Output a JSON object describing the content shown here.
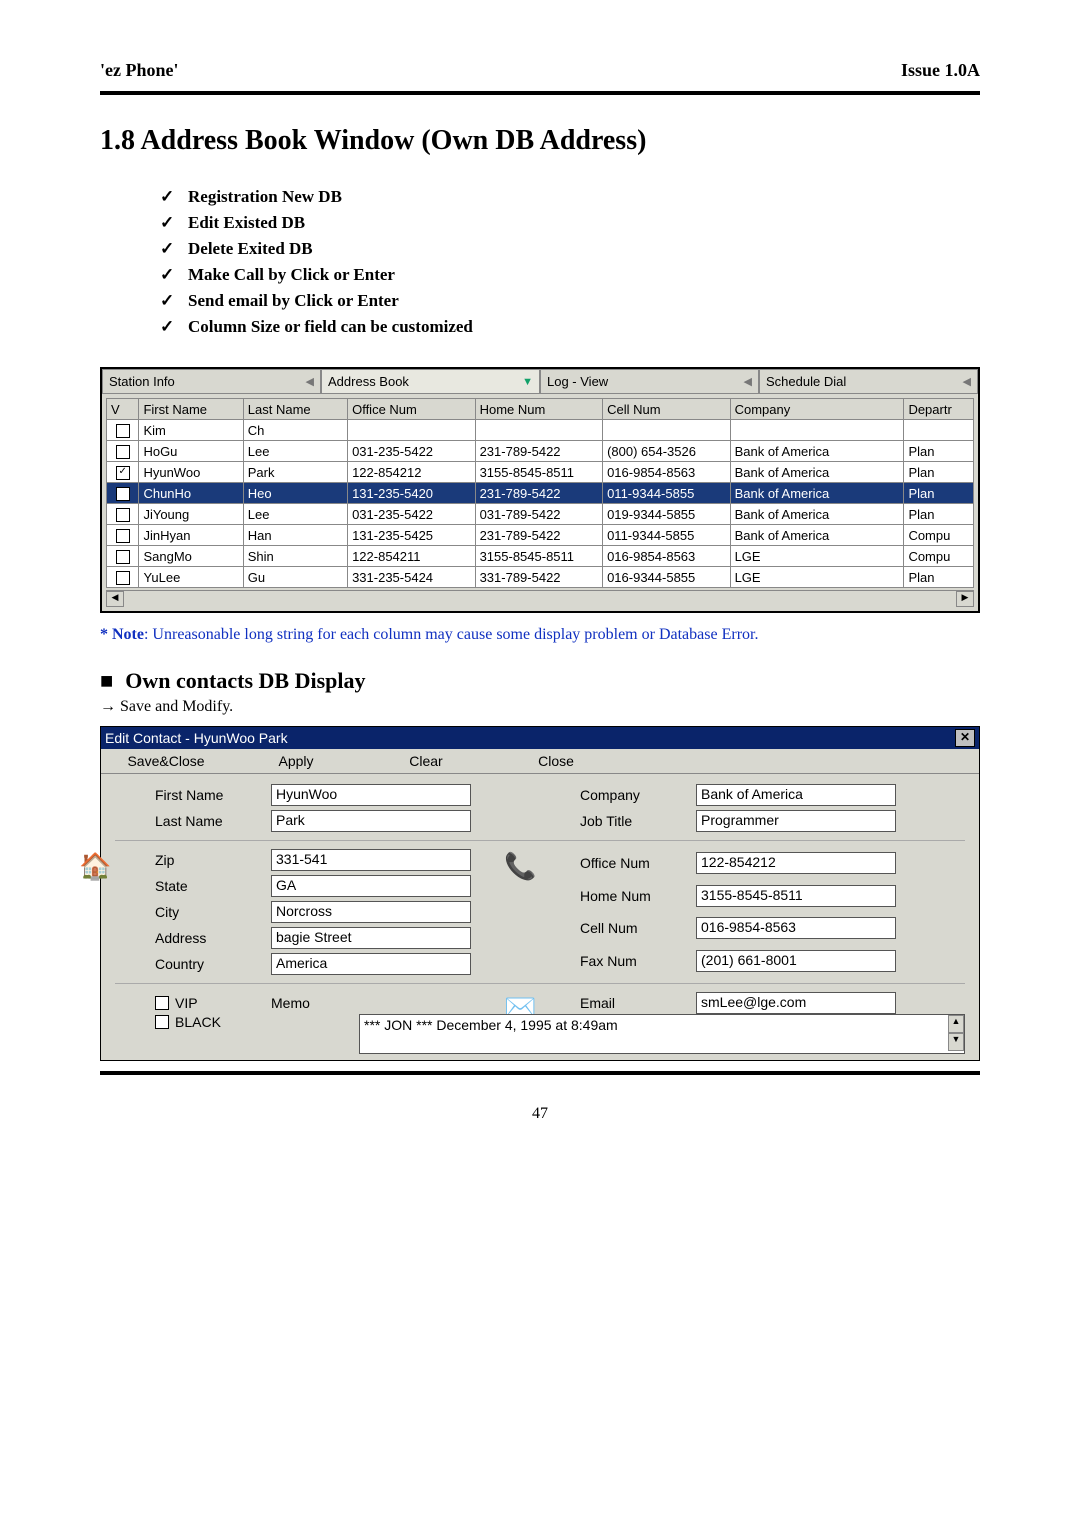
{
  "header": {
    "left": "'ez Phone'",
    "right": "Issue 1.0A"
  },
  "section_title": "1.8 Address Book Window (Own DB Address)",
  "features": [
    "Registration New DB",
    "Edit Existed DB",
    "Delete Exited DB",
    "Make Call by Click or Enter",
    "Send email by Click or Enter",
    "Column Size or field can be customized"
  ],
  "tabs": {
    "station_info": "Station Info",
    "address_book": "Address Book",
    "log_view": "Log - View",
    "schedule_dial": "Schedule Dial"
  },
  "grid": {
    "headers": {
      "v": "V",
      "first": "First Name",
      "last": "Last Name",
      "office": "Office Num",
      "home": "Home Num",
      "cell": "Cell Num",
      "company": "Company",
      "dept": "Departr"
    },
    "rows": [
      {
        "checked": false,
        "first": "Kim",
        "last": "Ch",
        "office": "",
        "home": "",
        "cell": "",
        "company": "",
        "dept": ""
      },
      {
        "checked": false,
        "first": "HoGu",
        "last": "Lee",
        "office": "031-235-5422",
        "home": "231-789-5422",
        "cell": "(800) 654-3526",
        "company": "Bank of America",
        "dept": "Plan"
      },
      {
        "checked": true,
        "first": "HyunWoo",
        "last": "Park",
        "office": "122-854212",
        "home": "3155-8545-8511",
        "cell": "016-9854-8563",
        "company": "Bank of America",
        "dept": "Plan"
      },
      {
        "checked": true,
        "first": "ChunHo",
        "last": "Heo",
        "office": "131-235-5420",
        "home": "231-789-5422",
        "cell": "011-9344-5855",
        "company": "Bank of America",
        "dept": "Plan",
        "selected": true
      },
      {
        "checked": false,
        "first": "JiYoung",
        "last": "Lee",
        "office": "031-235-5422",
        "home": "031-789-5422",
        "cell": "019-9344-5855",
        "company": "Bank of America",
        "dept": "Plan"
      },
      {
        "checked": false,
        "first": "JinHyan",
        "last": "Han",
        "office": "131-235-5425",
        "home": "231-789-5422",
        "cell": "011-9344-5855",
        "company": "Bank of America",
        "dept": "Compu"
      },
      {
        "checked": false,
        "first": "SangMo",
        "last": "Shin",
        "office": "122-854211",
        "home": "3155-8545-8511",
        "cell": "016-9854-8563",
        "company": "LGE",
        "dept": "Compu"
      },
      {
        "checked": false,
        "first": "YuLee",
        "last": "Gu",
        "office": "331-235-5424",
        "home": "331-789-5422",
        "cell": "016-9344-5855",
        "company": "LGE",
        "dept": "Plan"
      }
    ]
  },
  "note_label": "* Note",
  "note_rest": ": Unreasonable long string for each column may cause some display problem or ",
  "note_tail": "Database Error.",
  "subhead": "Own contacts DB Display",
  "subline": "Save and Modify.",
  "dialog": {
    "title": "Edit Contact - HyunWoo Park",
    "menu": {
      "saveclose": "Save&Close",
      "apply": "Apply",
      "clear": "Clear",
      "close": "Close"
    },
    "labels": {
      "first": "First Name",
      "last": "Last Name",
      "company": "Company",
      "job": "Job Title",
      "zip": "Zip",
      "state": "State",
      "city": "City",
      "address": "Address",
      "country": "Country",
      "office": "Office Num",
      "home": "Home Num",
      "cell": "Cell Num",
      "fax": "Fax Num",
      "email": "Email",
      "vip": "VIP",
      "black": "BLACK",
      "memo": "Memo"
    },
    "values": {
      "first": "HyunWoo",
      "last": "Park",
      "company": "Bank of America",
      "job": "Programmer",
      "zip": "331-541",
      "state": "GA",
      "city": "Norcross",
      "address": "bagie Street",
      "country": "America",
      "office": "122-854212",
      "home": "3155-8545-8511",
      "cell": "016-9854-8563",
      "fax": "(201) 661-8001",
      "email": "smLee@lge.com",
      "memo": "*** JON ***  December 4, 1995 at  8:49am"
    }
  },
  "page_number": "47"
}
